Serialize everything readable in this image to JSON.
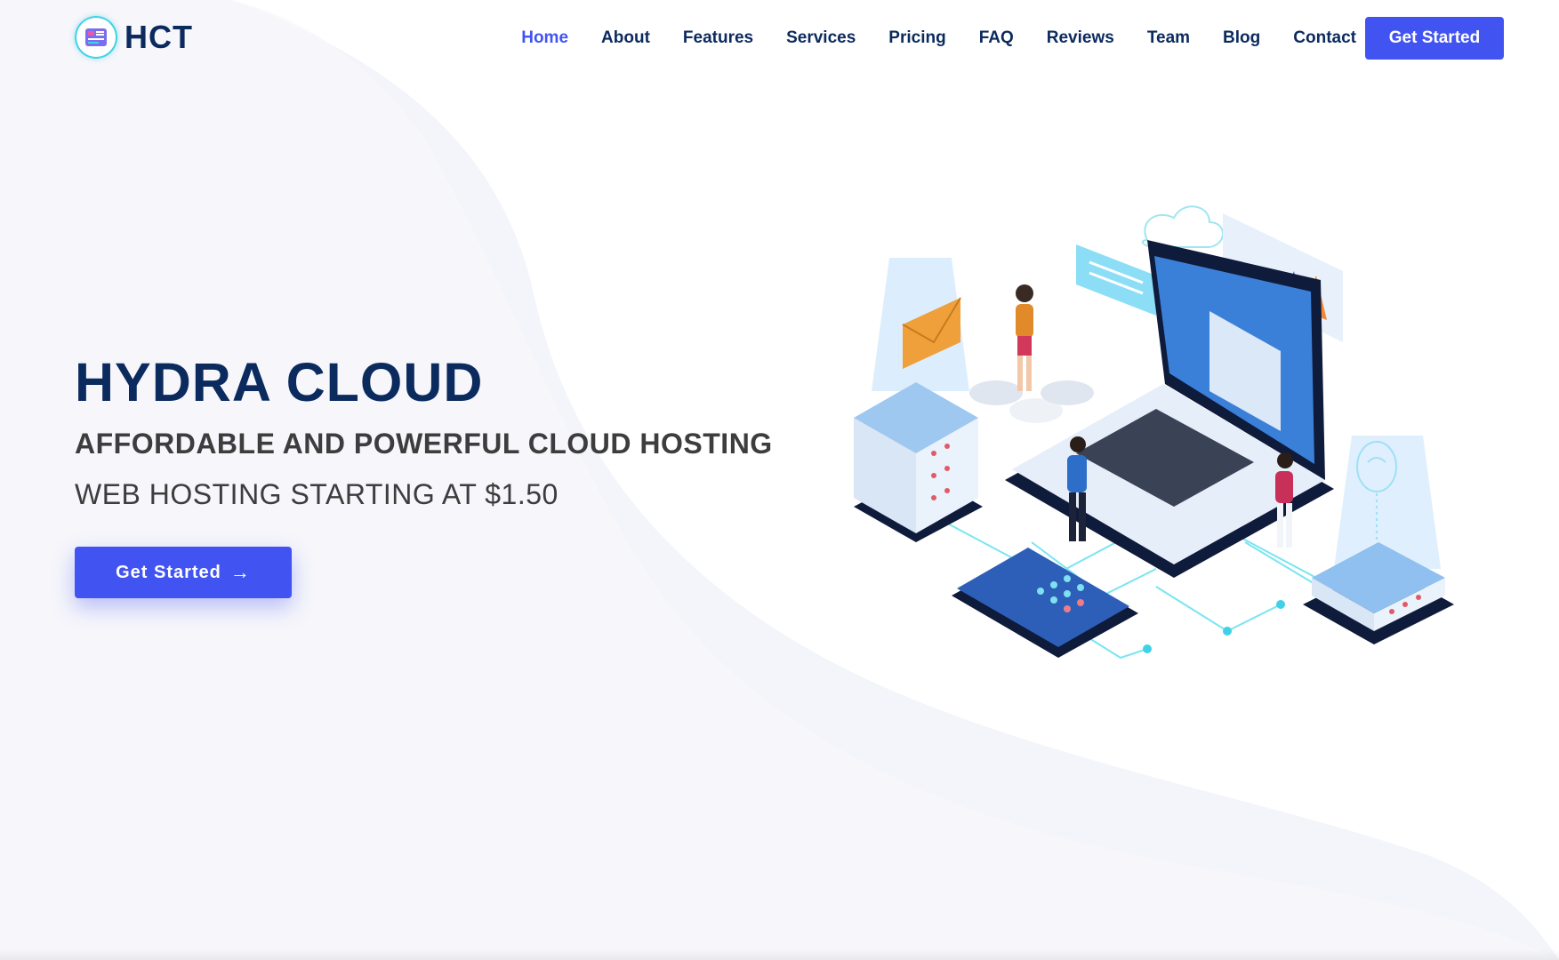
{
  "brand": {
    "name": "HCT"
  },
  "nav": {
    "items": [
      {
        "label": "Home",
        "active": true
      },
      {
        "label": "About"
      },
      {
        "label": "Features"
      },
      {
        "label": "Services"
      },
      {
        "label": "Pricing"
      },
      {
        "label": "FAQ"
      },
      {
        "label": "Reviews"
      },
      {
        "label": "Team"
      },
      {
        "label": "Blog"
      },
      {
        "label": "Contact"
      }
    ],
    "cta_label": "Get Started"
  },
  "hero": {
    "title": "HYDRA CLOUD",
    "subtitle": "AFFORDABLE AND POWERFUL CLOUD HOSTING",
    "tagline": "WEB HOSTING STARTING AT $1.50",
    "button_label": "Get Started",
    "button_icon": "arrow-right-icon"
  },
  "illustration": {
    "icons": [
      "server-rack-icon",
      "laptop-icon",
      "smartphone-icon",
      "cloud-icon",
      "envelope-icon",
      "chart-icon",
      "wifi-icon"
    ]
  },
  "colors": {
    "accent": "#4154f1",
    "heading": "#0b2a5e",
    "text": "#3d3d3d",
    "background": "#f3f5fa",
    "cyan": "#3fd2e6"
  }
}
